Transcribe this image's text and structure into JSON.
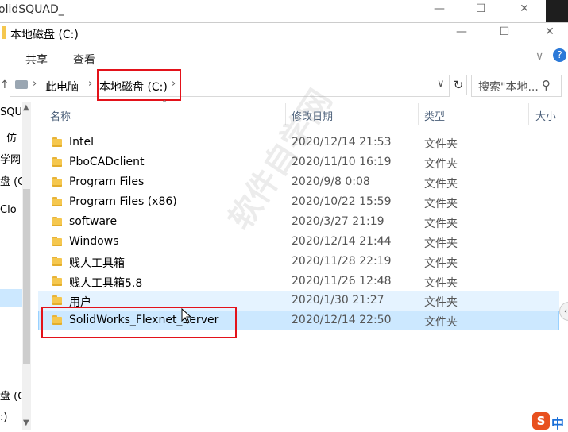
{
  "back_window": {
    "title": "olidSQUAD_",
    "controls": [
      "—",
      "☐",
      "✕"
    ]
  },
  "window": {
    "title": "本地磁盘 (C:)",
    "controls": [
      "—",
      "☐",
      "✕"
    ]
  },
  "ribbon": {
    "tabs": [
      "共享",
      "查看"
    ]
  },
  "address": {
    "arrow": "↑",
    "crumbs": [
      "此电脑",
      "本地磁盘 (C:)"
    ],
    "sep": "›"
  },
  "search": {
    "placeholder": "搜索\"本地..."
  },
  "nav_left": [
    "SQU",
    "仿",
    "学网",
    "盘 (C",
    "Clo",
    "盘 (C",
    ":)"
  ],
  "columns": {
    "name": "名称",
    "date": "修改日期",
    "type": "类型",
    "size": "大小"
  },
  "files": [
    {
      "name": "Intel",
      "date": "2020/12/14 21:53",
      "type": "文件夹"
    },
    {
      "name": "PboCADclient",
      "date": "2020/11/10 16:19",
      "type": "文件夹"
    },
    {
      "name": "Program Files",
      "date": "2020/9/8 0:08",
      "type": "文件夹"
    },
    {
      "name": "Program Files (x86)",
      "date": "2020/10/22 15:59",
      "type": "文件夹"
    },
    {
      "name": "software",
      "date": "2020/3/27 21:19",
      "type": "文件夹"
    },
    {
      "name": "Windows",
      "date": "2020/12/14 21:44",
      "type": "文件夹"
    },
    {
      "name": "贱人工具箱",
      "date": "2020/11/28 22:19",
      "type": "文件夹"
    },
    {
      "name": "贱人工具箱5.8",
      "date": "2020/11/26 12:48",
      "type": "文件夹"
    },
    {
      "name": "用户",
      "date": "2020/1/30 21:27",
      "type": "文件夹"
    },
    {
      "name": "SolidWorks_Flexnet_Server",
      "date": "2020/12/14 22:50",
      "type": "文件夹"
    }
  ],
  "watermark": "软件自学网",
  "ime": {
    "logo": "S",
    "label": "中"
  },
  "colors": {
    "highlight": "#e3121a",
    "selected": "#cce8ff",
    "hover": "#e5f3ff",
    "folder": "#f5c74e"
  }
}
